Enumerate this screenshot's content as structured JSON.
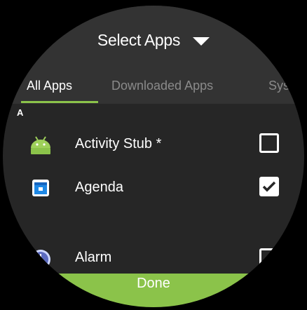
{
  "header": {
    "title": "Select Apps",
    "dropdown_icon": "caret-down-icon"
  },
  "tabs": [
    {
      "label": "All Apps",
      "active": true
    },
    {
      "label": "Downloaded Apps",
      "active": false
    },
    {
      "label": "Sys",
      "active": false
    }
  ],
  "section": {
    "letter": "A"
  },
  "apps": [
    {
      "label": "Activity Stub *",
      "icon": "android-icon",
      "checked": false
    },
    {
      "label": "Agenda",
      "icon": "calendar-icon",
      "checked": true
    },
    {
      "label": "Alarm",
      "icon": "clock-icon",
      "checked": false
    }
  ],
  "footer": {
    "done_label": "Done"
  },
  "colors": {
    "accent": "#8bc34a",
    "background": "#262626",
    "header": "#333333",
    "inactive_tab": "#8a8a8a"
  }
}
